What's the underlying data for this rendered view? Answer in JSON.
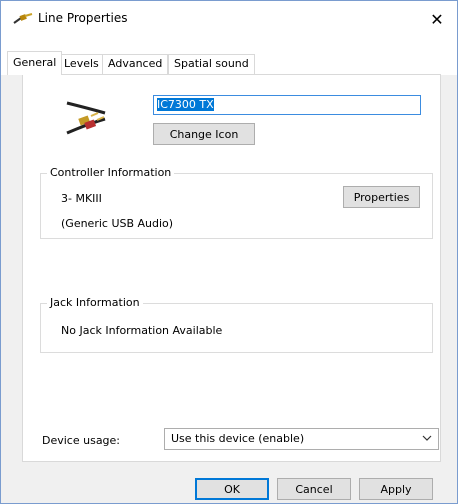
{
  "window": {
    "title": "Line Properties",
    "close_label": "✕"
  },
  "tabs": [
    {
      "label": "General",
      "active": true
    },
    {
      "label": "Levels",
      "active": false
    },
    {
      "label": "Advanced",
      "active": false
    },
    {
      "label": "Spatial sound",
      "active": false
    }
  ],
  "general": {
    "device_name": "IC7300 TX",
    "change_icon_label": "Change Icon",
    "controller": {
      "title": "Controller Information",
      "name": "3- MKIII",
      "driver": "(Generic USB Audio)",
      "properties_label": "Properties"
    },
    "jack": {
      "title": "Jack Information",
      "status": "No Jack Information Available"
    },
    "device_usage": {
      "label": "Device usage:",
      "selected": "Use this device (enable)"
    }
  },
  "footer": {
    "ok_label": "OK",
    "cancel_label": "Cancel",
    "apply_label": "Apply"
  },
  "colors": {
    "accent": "#0078d7",
    "window_border": "#7a9ccf",
    "background": "#f0f0f0"
  }
}
